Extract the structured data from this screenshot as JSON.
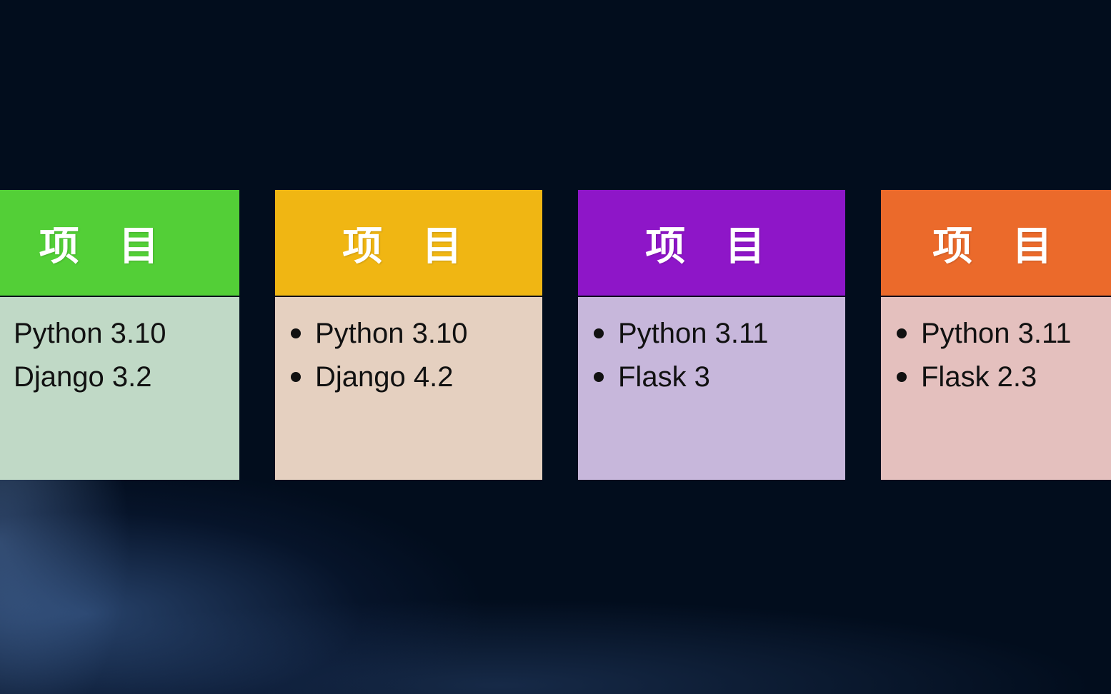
{
  "cards": [
    {
      "title": "项 目",
      "header_color": "#53cf37",
      "body_color": "#c0d9c6",
      "items": [
        "Python 3.10",
        "Django 3.2"
      ]
    },
    {
      "title": "项 目",
      "header_color": "#f0b613",
      "body_color": "#e5d0c0",
      "items": [
        "Python 3.10",
        "Django 4.2"
      ]
    },
    {
      "title": "项 目",
      "header_color": "#8e16c8",
      "body_color": "#c7b7db",
      "items": [
        "Python 3.11",
        "Flask 3"
      ]
    },
    {
      "title": "项 目",
      "header_color": "#eb6a2b",
      "body_color": "#e4c0be",
      "items": [
        "Python 3.11",
        "Flask 2.3"
      ]
    }
  ]
}
